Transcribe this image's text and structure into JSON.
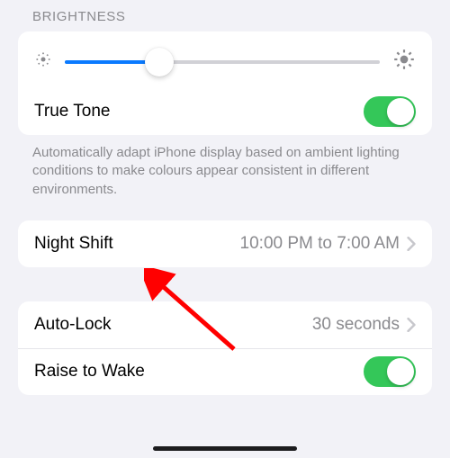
{
  "section_header": "BRIGHTNESS",
  "brightness": {
    "percent": 30
  },
  "true_tone": {
    "label": "True Tone",
    "on": true
  },
  "true_tone_footer": "Automatically adapt iPhone display based on ambient lighting conditions to make colours appear consistent in different environments.",
  "night_shift": {
    "label": "Night Shift",
    "value": "10:00 PM to 7:00 AM"
  },
  "auto_lock": {
    "label": "Auto-Lock",
    "value": "30 seconds"
  },
  "raise_to_wake": {
    "label": "Raise to Wake",
    "on": true
  }
}
